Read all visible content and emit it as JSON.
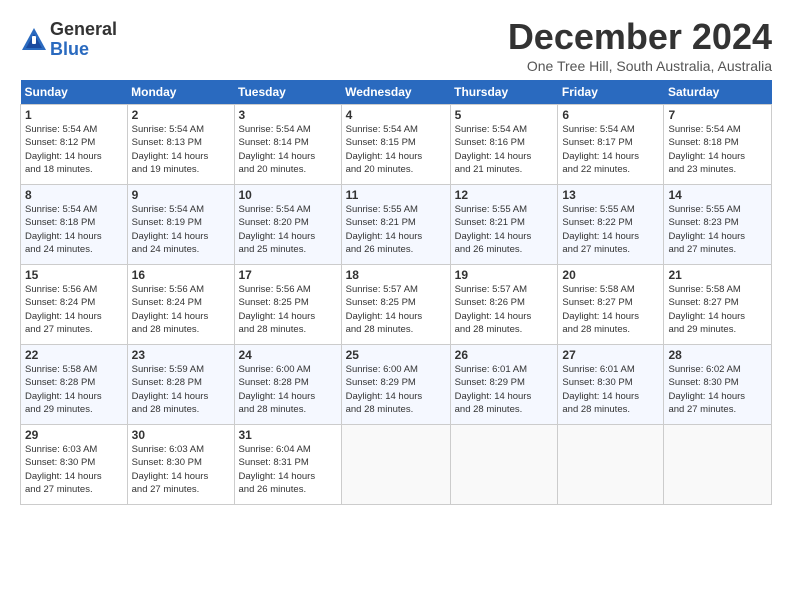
{
  "header": {
    "logo_general": "General",
    "logo_blue": "Blue",
    "title": "December 2024",
    "location": "One Tree Hill, South Australia, Australia"
  },
  "calendar": {
    "headers": [
      "Sunday",
      "Monday",
      "Tuesday",
      "Wednesday",
      "Thursday",
      "Friday",
      "Saturday"
    ],
    "weeks": [
      [
        {
          "day": "1",
          "info": "Sunrise: 5:54 AM\nSunset: 8:12 PM\nDaylight: 14 hours\nand 18 minutes."
        },
        {
          "day": "2",
          "info": "Sunrise: 5:54 AM\nSunset: 8:13 PM\nDaylight: 14 hours\nand 19 minutes."
        },
        {
          "day": "3",
          "info": "Sunrise: 5:54 AM\nSunset: 8:14 PM\nDaylight: 14 hours\nand 20 minutes."
        },
        {
          "day": "4",
          "info": "Sunrise: 5:54 AM\nSunset: 8:15 PM\nDaylight: 14 hours\nand 20 minutes."
        },
        {
          "day": "5",
          "info": "Sunrise: 5:54 AM\nSunset: 8:16 PM\nDaylight: 14 hours\nand 21 minutes."
        },
        {
          "day": "6",
          "info": "Sunrise: 5:54 AM\nSunset: 8:17 PM\nDaylight: 14 hours\nand 22 minutes."
        },
        {
          "day": "7",
          "info": "Sunrise: 5:54 AM\nSunset: 8:18 PM\nDaylight: 14 hours\nand 23 minutes."
        }
      ],
      [
        {
          "day": "8",
          "info": "Sunrise: 5:54 AM\nSunset: 8:18 PM\nDaylight: 14 hours\nand 24 minutes."
        },
        {
          "day": "9",
          "info": "Sunrise: 5:54 AM\nSunset: 8:19 PM\nDaylight: 14 hours\nand 24 minutes."
        },
        {
          "day": "10",
          "info": "Sunrise: 5:54 AM\nSunset: 8:20 PM\nDaylight: 14 hours\nand 25 minutes."
        },
        {
          "day": "11",
          "info": "Sunrise: 5:55 AM\nSunset: 8:21 PM\nDaylight: 14 hours\nand 26 minutes."
        },
        {
          "day": "12",
          "info": "Sunrise: 5:55 AM\nSunset: 8:21 PM\nDaylight: 14 hours\nand 26 minutes."
        },
        {
          "day": "13",
          "info": "Sunrise: 5:55 AM\nSunset: 8:22 PM\nDaylight: 14 hours\nand 27 minutes."
        },
        {
          "day": "14",
          "info": "Sunrise: 5:55 AM\nSunset: 8:23 PM\nDaylight: 14 hours\nand 27 minutes."
        }
      ],
      [
        {
          "day": "15",
          "info": "Sunrise: 5:56 AM\nSunset: 8:24 PM\nDaylight: 14 hours\nand 27 minutes."
        },
        {
          "day": "16",
          "info": "Sunrise: 5:56 AM\nSunset: 8:24 PM\nDaylight: 14 hours\nand 28 minutes."
        },
        {
          "day": "17",
          "info": "Sunrise: 5:56 AM\nSunset: 8:25 PM\nDaylight: 14 hours\nand 28 minutes."
        },
        {
          "day": "18",
          "info": "Sunrise: 5:57 AM\nSunset: 8:25 PM\nDaylight: 14 hours\nand 28 minutes."
        },
        {
          "day": "19",
          "info": "Sunrise: 5:57 AM\nSunset: 8:26 PM\nDaylight: 14 hours\nand 28 minutes."
        },
        {
          "day": "20",
          "info": "Sunrise: 5:58 AM\nSunset: 8:27 PM\nDaylight: 14 hours\nand 28 minutes."
        },
        {
          "day": "21",
          "info": "Sunrise: 5:58 AM\nSunset: 8:27 PM\nDaylight: 14 hours\nand 29 minutes."
        }
      ],
      [
        {
          "day": "22",
          "info": "Sunrise: 5:58 AM\nSunset: 8:28 PM\nDaylight: 14 hours\nand 29 minutes."
        },
        {
          "day": "23",
          "info": "Sunrise: 5:59 AM\nSunset: 8:28 PM\nDaylight: 14 hours\nand 28 minutes."
        },
        {
          "day": "24",
          "info": "Sunrise: 6:00 AM\nSunset: 8:28 PM\nDaylight: 14 hours\nand 28 minutes."
        },
        {
          "day": "25",
          "info": "Sunrise: 6:00 AM\nSunset: 8:29 PM\nDaylight: 14 hours\nand 28 minutes."
        },
        {
          "day": "26",
          "info": "Sunrise: 6:01 AM\nSunset: 8:29 PM\nDaylight: 14 hours\nand 28 minutes."
        },
        {
          "day": "27",
          "info": "Sunrise: 6:01 AM\nSunset: 8:30 PM\nDaylight: 14 hours\nand 28 minutes."
        },
        {
          "day": "28",
          "info": "Sunrise: 6:02 AM\nSunset: 8:30 PM\nDaylight: 14 hours\nand 27 minutes."
        }
      ],
      [
        {
          "day": "29",
          "info": "Sunrise: 6:03 AM\nSunset: 8:30 PM\nDaylight: 14 hours\nand 27 minutes."
        },
        {
          "day": "30",
          "info": "Sunrise: 6:03 AM\nSunset: 8:30 PM\nDaylight: 14 hours\nand 27 minutes."
        },
        {
          "day": "31",
          "info": "Sunrise: 6:04 AM\nSunset: 8:31 PM\nDaylight: 14 hours\nand 26 minutes."
        },
        {
          "day": "",
          "info": ""
        },
        {
          "day": "",
          "info": ""
        },
        {
          "day": "",
          "info": ""
        },
        {
          "day": "",
          "info": ""
        }
      ]
    ]
  }
}
